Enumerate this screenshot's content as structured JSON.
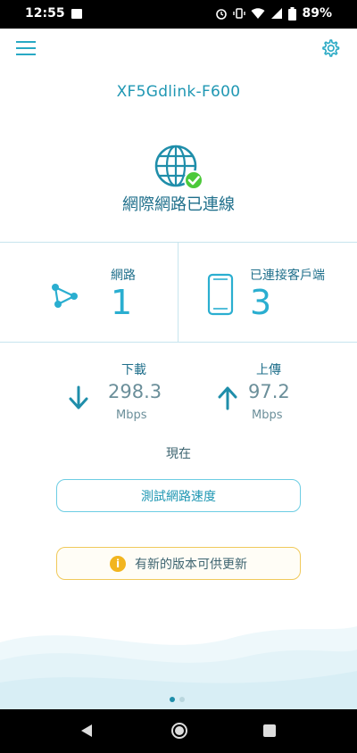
{
  "status_bar": {
    "time": "12:55",
    "battery": "89%"
  },
  "header": {
    "device_name": "XF5Gdlink-F600"
  },
  "connection": {
    "status_text": "網際網路已連線"
  },
  "stats": {
    "network_label": "網路",
    "network_count": "1",
    "clients_label": "已連接客戶端",
    "clients_count": "3"
  },
  "speed": {
    "download_label": "下載",
    "download_value": "298.3",
    "download_unit": "Mbps",
    "upload_label": "上傳",
    "upload_value": "97.2",
    "upload_unit": "Mbps",
    "time_label": "現在"
  },
  "actions": {
    "speedtest_label": "測試網路速度",
    "update_label": "有新的版本可供更新",
    "update_icon_glyph": "i"
  },
  "pagination": {
    "current": 1,
    "total": 2
  },
  "colors": {
    "accent": "#28a9c4",
    "warning": "#f2b51f",
    "success": "#4cc93a"
  },
  "icons": [
    "menu-icon",
    "gear-icon",
    "globe-icon",
    "check-badge-icon",
    "network-icon",
    "phone-icon",
    "down-arrow-icon",
    "up-arrow-icon",
    "info-icon",
    "back-icon",
    "home-icon",
    "recents-icon"
  ]
}
